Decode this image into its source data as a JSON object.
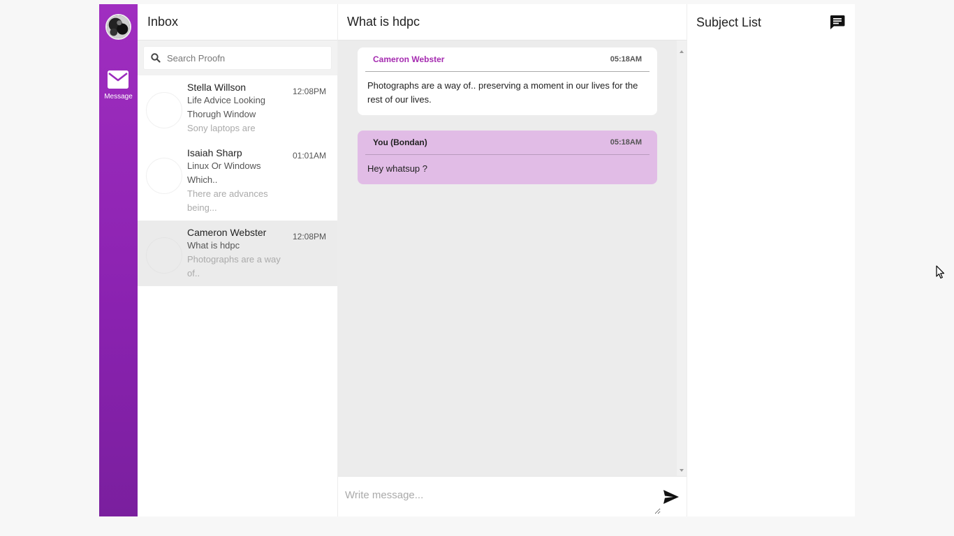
{
  "rail": {
    "message_label": "Message"
  },
  "inbox": {
    "title": "Inbox",
    "search_placeholder": "Search Proofn",
    "conversations": [
      {
        "name": "Stella Willson",
        "subject": "Life Advice Looking Thorugh Window",
        "preview": "Sony laptops are",
        "time": "12:08PM"
      },
      {
        "name": "Isaiah Sharp",
        "subject": "Linux Or Windows Which..",
        "preview": "There are advances being...",
        "time": "01:01AM"
      },
      {
        "name": "Cameron Webster",
        "subject": "What is hdpc",
        "preview": "Photographs are a way of..",
        "time": "12:08PM"
      }
    ]
  },
  "chat": {
    "title": "What is hdpc",
    "messages": [
      {
        "sender": "Cameron Webster",
        "time": "05:18AM",
        "text": "Photographs are a way of.. preserving a moment in our lives for the rest of our lives."
      },
      {
        "sender": "You (Bondan)",
        "time": "05:18AM",
        "text": "Hey whatsup ?"
      }
    ],
    "composer_placeholder": "Write message..."
  },
  "subjects": {
    "title": "Subject List"
  },
  "colors": {
    "accent": "#9b2bbd",
    "own_bubble": "#e1bce6",
    "active_row": "#ebebeb"
  }
}
